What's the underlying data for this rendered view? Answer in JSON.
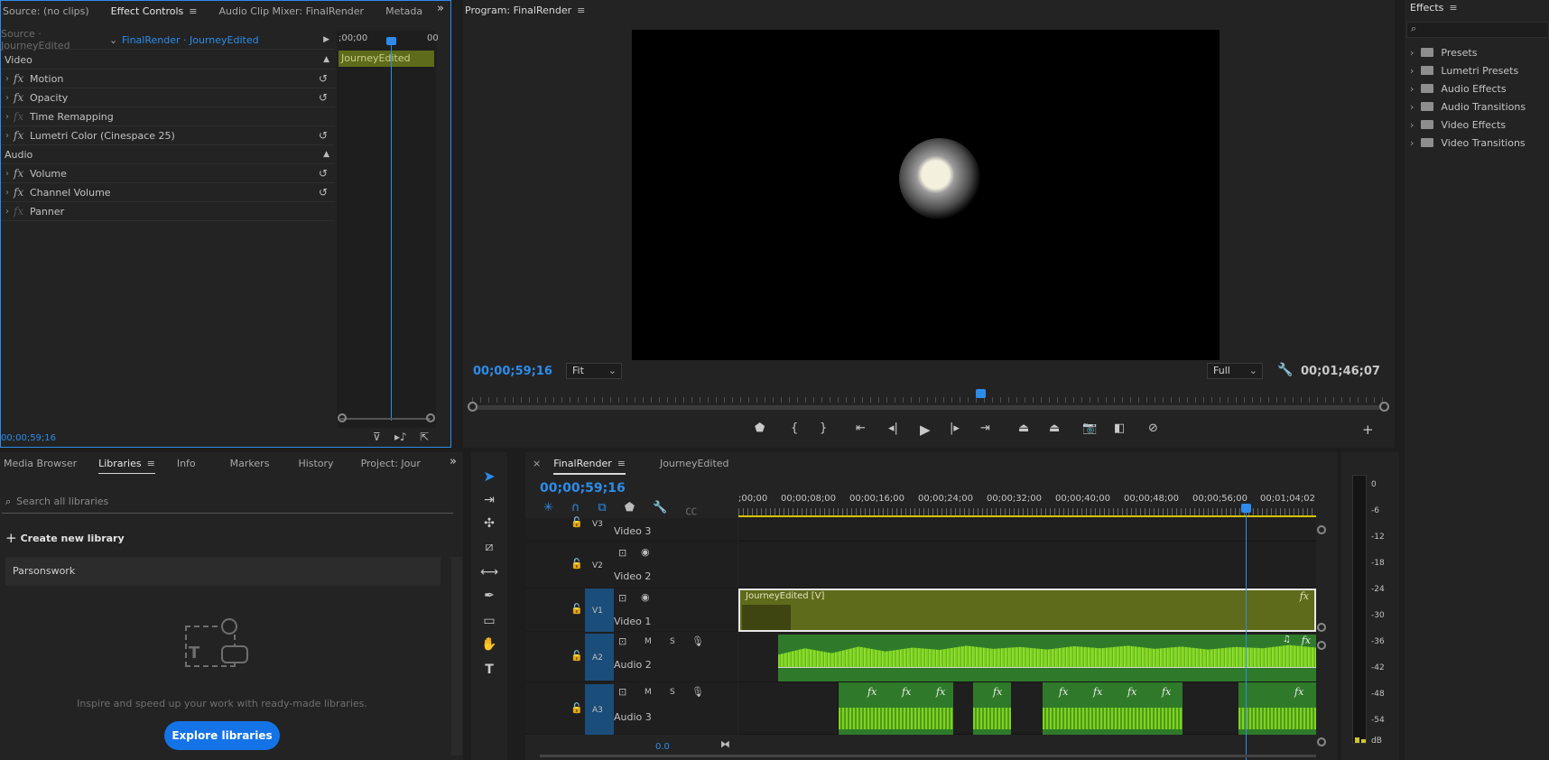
{
  "source_panel": {
    "tabs": [
      "Source: (no clips)",
      "Effect Controls",
      "Audio Clip Mixer: FinalRender",
      "Metada"
    ],
    "active": "Effect Controls",
    "more": "»"
  },
  "effect_controls": {
    "source_label": "Source · JourneyEdited",
    "sequence_label": "FinalRender · JourneyEdited",
    "ruler_left": ";00;00",
    "ruler_right": "00",
    "clip_name": "JourneyEdited",
    "video_section": "Video",
    "audio_section": "Audio",
    "rows": [
      {
        "name": "Motion",
        "reset": true,
        "enabled": true
      },
      {
        "name": "Opacity",
        "reset": true,
        "enabled": true
      },
      {
        "name": "Time Remapping",
        "reset": false,
        "enabled": false
      },
      {
        "name": "Lumetri Color (Cinespace 25)",
        "reset": true,
        "enabled": true
      },
      {
        "name": "Volume",
        "reset": true,
        "enabled": true
      },
      {
        "name": "Channel Volume",
        "reset": true,
        "enabled": true
      },
      {
        "name": "Panner",
        "reset": false,
        "enabled": false
      }
    ],
    "timecode": "00;00;59;16"
  },
  "program": {
    "title": "Program: FinalRender",
    "timecode": "00;00;59;16",
    "fit": "Fit",
    "quality": "Full",
    "duration": "00;01;46;07"
  },
  "bottom_left": {
    "tabs": [
      "Media Browser",
      "Libraries",
      "Info",
      "Markers",
      "History",
      "Project: Jour"
    ],
    "active": "Libraries",
    "search_placeholder": "Search all libraries",
    "create": "Create new library",
    "library": "Parsonswork",
    "inspire": "Inspire and speed up your work with ready-made libraries.",
    "explore": "Explore libraries"
  },
  "timeline": {
    "tabs": [
      "FinalRender",
      "JourneyEdited"
    ],
    "timecode": "00;00;59;16",
    "ruler": [
      ";00;00",
      "00;00;08;00",
      "00;00;16;00",
      "00;00;24;00",
      "00;00;32;00",
      "00;00;40;00",
      "00;00;48;00",
      "00;00;56;00",
      "00;01;04;02"
    ],
    "tracks": [
      {
        "id": "V3",
        "name": "Video 3"
      },
      {
        "id": "V2",
        "name": "Video 2"
      },
      {
        "id": "V1",
        "name": "Video 1"
      },
      {
        "id": "A2",
        "name": "Audio 2"
      },
      {
        "id": "A3",
        "name": "Audio 3"
      }
    ],
    "clip_label": "JourneyEdited [V]",
    "zoom": "0.0",
    "mute": "M",
    "solo": "S"
  },
  "effects": {
    "title": "Effects",
    "items": [
      "Presets",
      "Lumetri Presets",
      "Audio Effects",
      "Audio Transitions",
      "Video Effects",
      "Video Transitions"
    ]
  },
  "meter": {
    "labels": [
      "0",
      "-6",
      "-12",
      "-18",
      "-24",
      "-30",
      "-36",
      "-42",
      "-48",
      "-54",
      "dB"
    ]
  },
  "colors": {
    "accent": "#2d8ceb",
    "clip_video": "#5e6b1a",
    "clip_audio": "#2f8a2a",
    "wave": "#7ed321",
    "track_active": "#1a4d7a"
  }
}
